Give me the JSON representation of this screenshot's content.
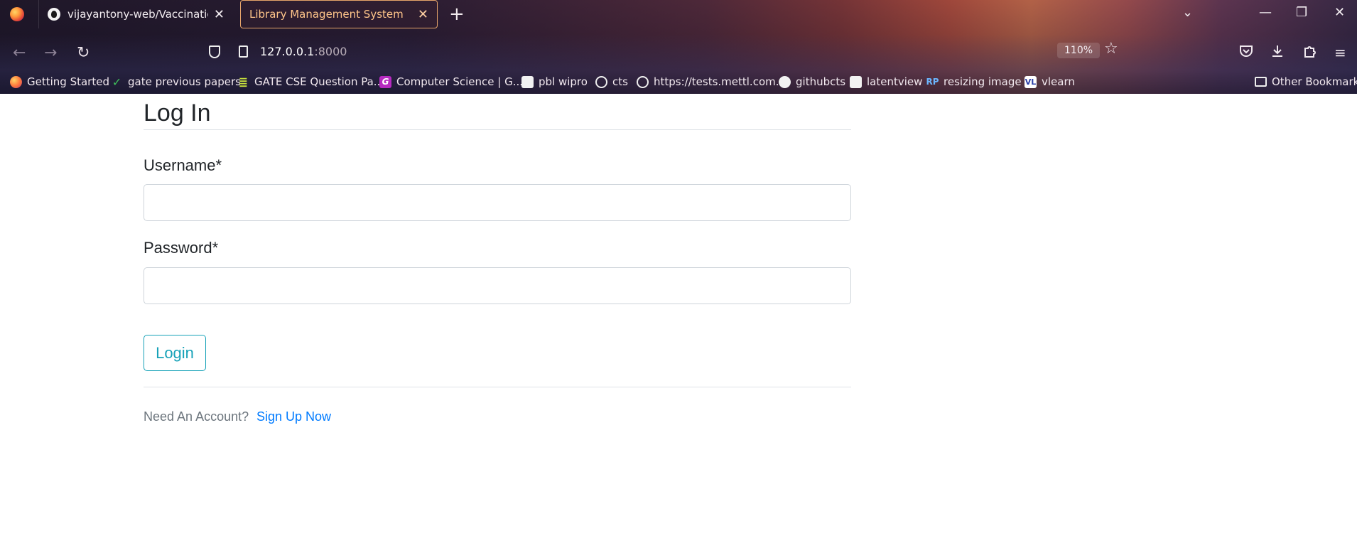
{
  "browser": {
    "tabs": [
      {
        "label": "vijayantony-web/Vaccination_B",
        "active": false
      },
      {
        "label": "Library Management System",
        "active": true
      }
    ],
    "url_host": "127.0.0.1",
    "url_port": ":8000",
    "zoom": "110%",
    "bookmarks": [
      {
        "label": "Getting Started",
        "icon": "firefox-icon"
      },
      {
        "label": "gate previous papers",
        "icon": "checkmark-icon"
      },
      {
        "label": "GATE CSE Question Pa...",
        "icon": "stack-icon"
      },
      {
        "label": "Computer Science | G...",
        "icon": "g-icon"
      },
      {
        "label": "pbl wipro",
        "icon": "page-icon"
      },
      {
        "label": "cts",
        "icon": "globe-icon"
      },
      {
        "label": "https://tests.mettl.com...",
        "icon": "globe-icon"
      },
      {
        "label": "githubcts",
        "icon": "github-icon"
      },
      {
        "label": "latentview",
        "icon": "site-icon"
      },
      {
        "label": "resizing image",
        "icon": "rp-icon"
      },
      {
        "label": "vlearn",
        "icon": "vl-icon"
      }
    ],
    "other_bookmarks": "Other Bookmarks",
    "icons": {
      "plus": "+",
      "close": "✕",
      "back": "←",
      "forward": "→",
      "reload": "↻",
      "star": "☆",
      "menu": "≡",
      "chevron": "⌄",
      "minimize": "—",
      "restore": "❐"
    }
  },
  "page": {
    "title": "Log In",
    "username_label": "Username*",
    "username_value": "",
    "password_label": "Password*",
    "password_value": "",
    "login_button": "Login",
    "footer_text": "Need An Account?",
    "signup_link": "Sign Up Now"
  },
  "colors": {
    "accent": "#17a2b8",
    "link": "#007bff",
    "muted": "#6c757d",
    "active_tab": "#ffc58a"
  }
}
